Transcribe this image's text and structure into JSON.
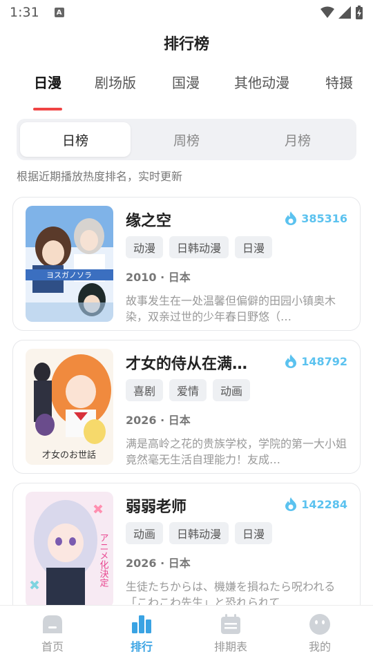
{
  "status": {
    "time": "1:31",
    "notif": "A"
  },
  "header": {
    "title": "排行榜"
  },
  "category_tabs": [
    "日漫",
    "剧场版",
    "国漫",
    "其他动漫",
    "特摄"
  ],
  "active_category": "日漫",
  "segments": [
    "日榜",
    "周榜",
    "月榜"
  ],
  "active_segment": "日榜",
  "hint": "根据近期播放热度排名，实时更新",
  "items": [
    {
      "title": "缘之空",
      "heat": "385316",
      "tags": [
        "动漫",
        "日韩动漫",
        "日漫"
      ],
      "meta": "2010 · 日本",
      "desc": "故事发生在一处温馨但偏僻的田园小镇奥木染，双亲过世的少年春日野悠（…",
      "poster_text": "ヨスガノソラ"
    },
    {
      "title": "才女的侍从在满…",
      "heat": "148792",
      "tags": [
        "喜剧",
        "爱情",
        "动画"
      ],
      "meta": "2026 · 日本",
      "desc": "满是高岭之花的贵族学校，学院的第一大小姐竟然毫无生活自理能力！友成…",
      "poster_text": "才女のお世話"
    },
    {
      "title": "弱弱老师",
      "heat": "142284",
      "tags": [
        "动画",
        "日韩动漫",
        "日漫"
      ],
      "meta": "2026 · 日本",
      "desc": "生徒たちからは、機嫌を損ねたら呪われる「こわこわ先生」と恐れられて…",
      "poster_text": "アニメ化決定"
    }
  ],
  "bottom_nav": [
    {
      "label": "首页",
      "icon": "home-icon"
    },
    {
      "label": "排行",
      "icon": "ranking-icon"
    },
    {
      "label": "排期表",
      "icon": "calendar-icon"
    },
    {
      "label": "我的",
      "icon": "profile-icon"
    }
  ],
  "active_nav": "排行",
  "colors": {
    "accent_red": "#f04444",
    "accent_blue": "#3aa3e3",
    "heat_blue": "#5bc2ef"
  }
}
